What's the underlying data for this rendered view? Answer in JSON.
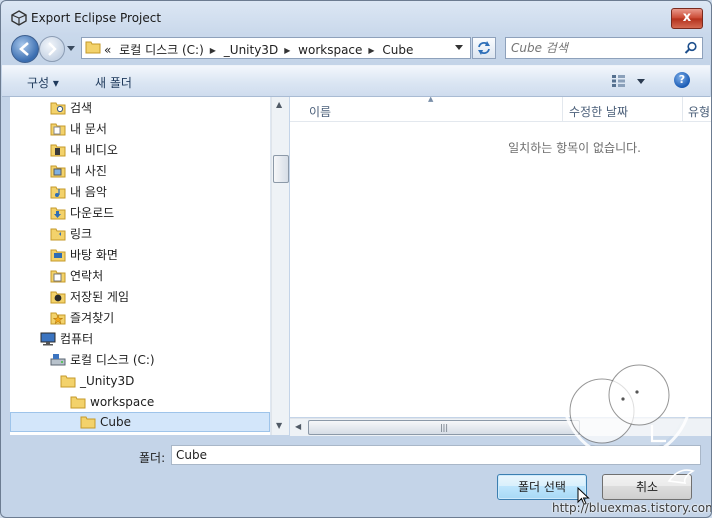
{
  "window": {
    "title": "Export Eclipse Project",
    "close_label": "x"
  },
  "address": {
    "overflow": "«",
    "crumbs": [
      "로컬 디스크 (C:)",
      "_Unity3D",
      "workspace",
      "Cube"
    ]
  },
  "search": {
    "placeholder": "Cube 검색"
  },
  "toolbar": {
    "organize_label": "구성 ▾",
    "new_folder_label": "새 폴더",
    "help_label": "?"
  },
  "nav": {
    "items": [
      {
        "label": "검색",
        "icon": "search-folder-icon"
      },
      {
        "label": "내 문서",
        "icon": "documents-folder-icon"
      },
      {
        "label": "내 비디오",
        "icon": "videos-folder-icon"
      },
      {
        "label": "내 사진",
        "icon": "pictures-folder-icon"
      },
      {
        "label": "내 음악",
        "icon": "music-folder-icon"
      },
      {
        "label": "다운로드",
        "icon": "downloads-folder-icon"
      },
      {
        "label": "링크",
        "icon": "links-folder-icon"
      },
      {
        "label": "바탕 화면",
        "icon": "desktop-folder-icon"
      },
      {
        "label": "연락처",
        "icon": "contacts-folder-icon"
      },
      {
        "label": "저장된 게임",
        "icon": "saved-games-folder-icon"
      },
      {
        "label": "즐겨찾기",
        "icon": "favorites-folder-icon"
      },
      {
        "label": "컴퓨터",
        "icon": "computer-icon"
      },
      {
        "label": "로컬 디스크 (C:)",
        "icon": "drive-icon"
      },
      {
        "label": "_Unity3D",
        "icon": "folder-icon"
      },
      {
        "label": "workspace",
        "icon": "folder-icon"
      },
      {
        "label": "Cube",
        "icon": "folder-icon"
      }
    ]
  },
  "content": {
    "columns": [
      "이름",
      "수정한 날짜",
      "유형"
    ],
    "empty_message": "일치하는 항목이 없습니다."
  },
  "footer": {
    "folder_label": "폴더:",
    "folder_value": "Cube",
    "select_button": "폴더 선택",
    "cancel_button": "취소"
  },
  "watermark": {
    "url": "http://bluexmas.tistory.com/"
  },
  "colors": {
    "selection": "#d3e6fa",
    "accent": "#3c7fb1"
  }
}
